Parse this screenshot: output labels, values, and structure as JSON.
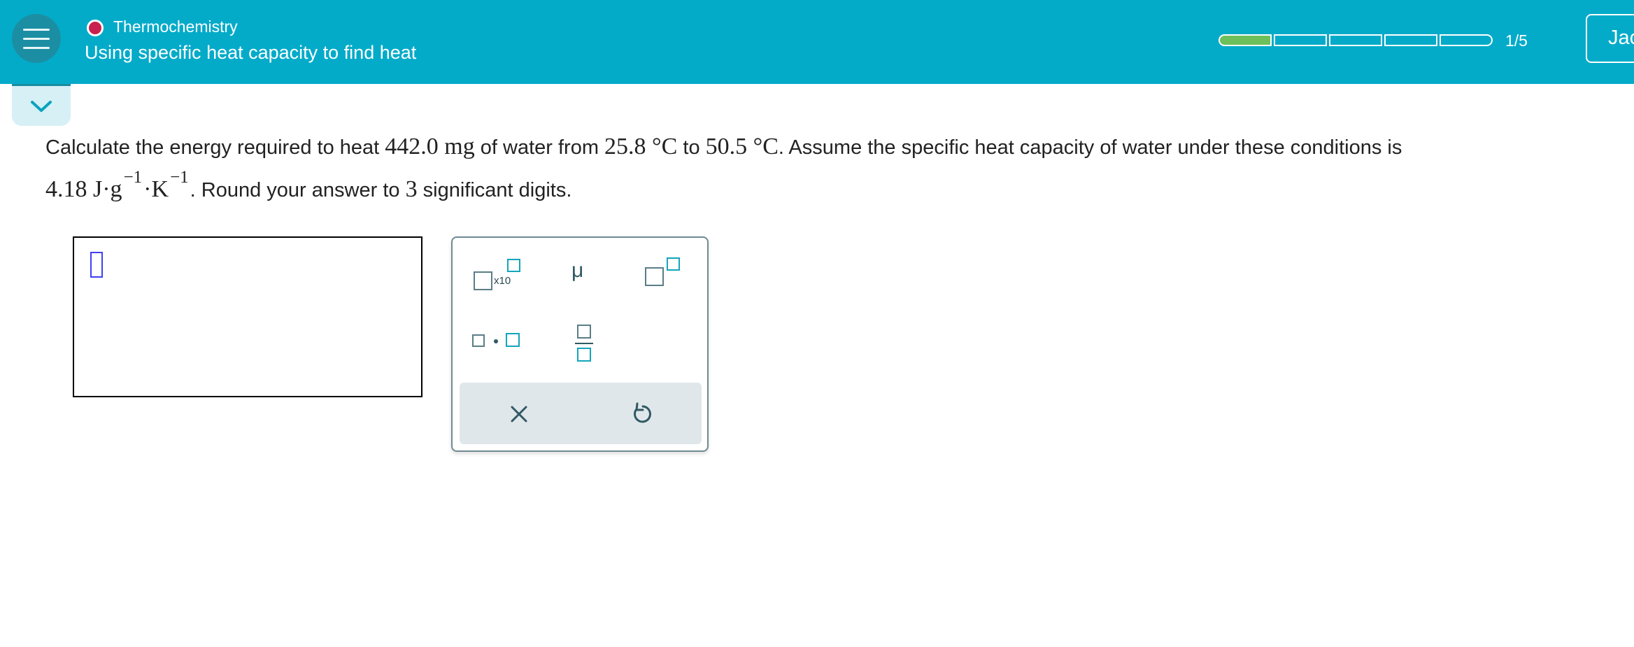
{
  "header": {
    "topic": "Thermochemistry",
    "subtitle": "Using specific heat capacity to find heat",
    "progress_text": "1/5",
    "progress_value": 0.2,
    "user_button_label": "Jac"
  },
  "question": {
    "p1": "Calculate the energy required to heat ",
    "mass": "442.0 mg",
    "p2": " of water from ",
    "t1": "25.8 °C",
    "p3": " to ",
    "t2": "50.5 °C",
    "p4": ". Assume the specific heat capacity of water under these conditions is",
    "c_val": "4.18 J·g",
    "exp1": "−1",
    "unit_k": "·K",
    "exp2": "−1",
    "p5": ". Round your answer to ",
    "sig": "3",
    "p6": " significant digits."
  },
  "palette": {
    "x10_label": "x10",
    "mu_label": "μ"
  },
  "colors": {
    "header_bg": "#03abc9",
    "progress_fill": "#6cbf5b",
    "topic_dot": "#c8204f",
    "cursor": "#3f41f2"
  }
}
